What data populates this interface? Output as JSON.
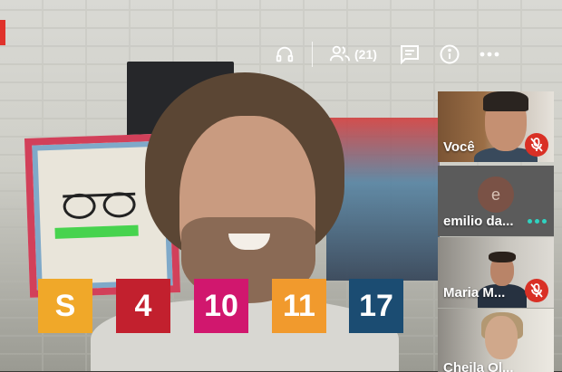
{
  "topbar": {
    "headphones_icon": "headphones-icon",
    "people_icon": "people-icon",
    "participant_count": "(21)",
    "chat_icon": "chat-icon",
    "info_icon": "info-icon",
    "more_icon": "more-icon"
  },
  "ods_tiles": [
    {
      "label": "S",
      "color": "#f0a829"
    },
    {
      "label": "4",
      "color": "#c2202e"
    },
    {
      "label": "10",
      "color": "#d1176e"
    },
    {
      "label": "11",
      "color": "#f19a2d"
    },
    {
      "label": "17",
      "color": "#1b4c72"
    }
  ],
  "participants": [
    {
      "name": "Você",
      "status": "muted"
    },
    {
      "name": "emilio da...",
      "avatar_letter": "e",
      "status": "speaking-dots"
    },
    {
      "name": "Maria M...",
      "status": "muted"
    },
    {
      "name": "Cheila Ol...",
      "status": "video"
    }
  ],
  "colors": {
    "mute_red": "#d93025",
    "speaking_teal": "#2fd3c1"
  }
}
